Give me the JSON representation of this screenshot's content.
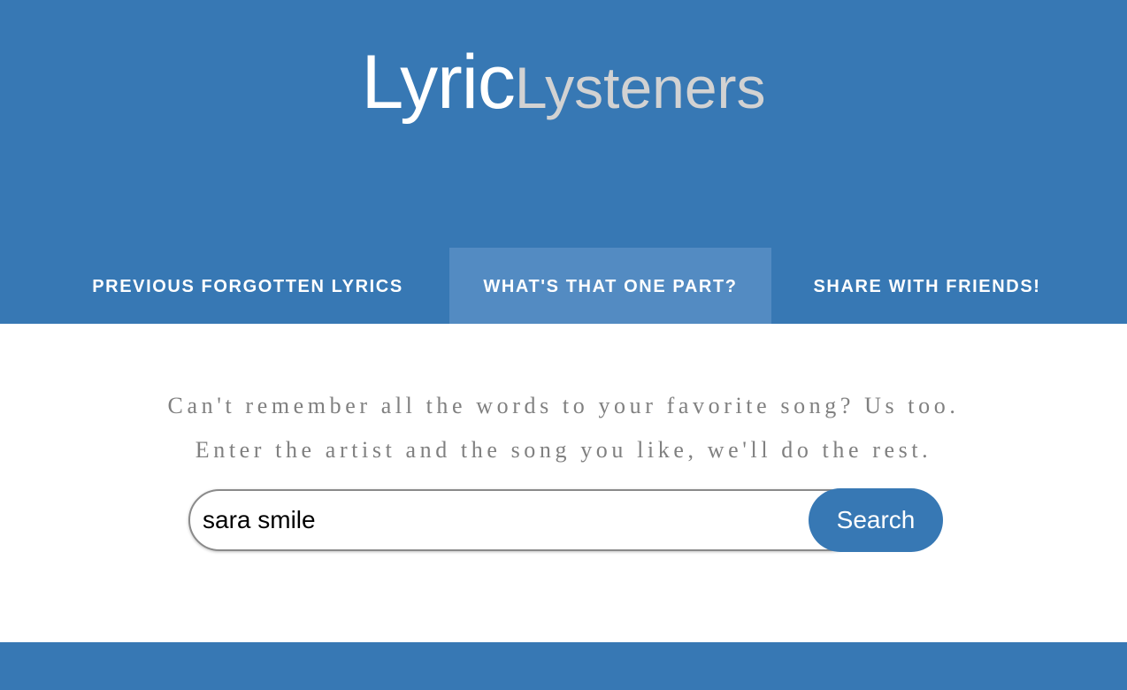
{
  "logo": {
    "part1": "Lyric",
    "part2": "Lysteners"
  },
  "nav": {
    "items": [
      {
        "label": "PREVIOUS FORGOTTEN LYRICS",
        "active": false
      },
      {
        "label": "WHAT'S THAT ONE PART?",
        "active": true
      },
      {
        "label": "SHARE WITH FRIENDS!",
        "active": false
      }
    ]
  },
  "tagline": {
    "line1": "Can't remember all the words to your favorite song? Us too.",
    "line2": "Enter the artist and the song you like, we'll do the rest."
  },
  "search": {
    "value": "sara smile",
    "button_label": "Search"
  },
  "colors": {
    "brand_blue": "#3778b4",
    "nav_active": "#538bc2",
    "logo_secondary": "#d2d2d2",
    "tagline_gray": "#808080"
  }
}
